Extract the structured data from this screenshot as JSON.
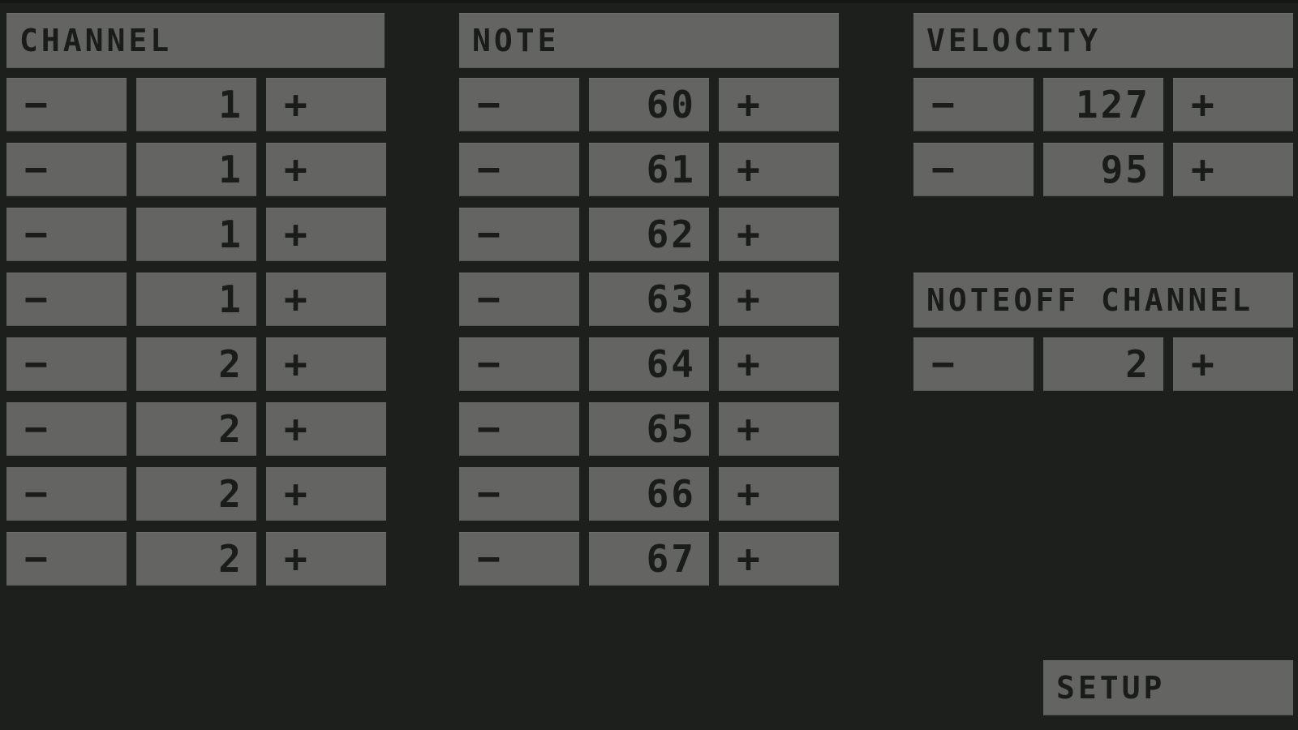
{
  "minus_label": "−",
  "plus_label": "+",
  "channel": {
    "title": "CHANNEL",
    "rows": [
      "1",
      "1",
      "1",
      "1",
      "2",
      "2",
      "2",
      "2"
    ]
  },
  "note": {
    "title": "NOTE",
    "rows": [
      "60",
      "61",
      "62",
      "63",
      "64",
      "65",
      "66",
      "67"
    ]
  },
  "velocity": {
    "title": "VELOCITY",
    "rows": [
      "127",
      "95"
    ]
  },
  "noteoff_channel": {
    "title": "NOTEOFF CHANNEL",
    "value": "2"
  },
  "setup_label": "SETUP",
  "colors": {
    "background": "#1d1f1c",
    "panel": "#646562",
    "text": "#1a1c1a"
  }
}
